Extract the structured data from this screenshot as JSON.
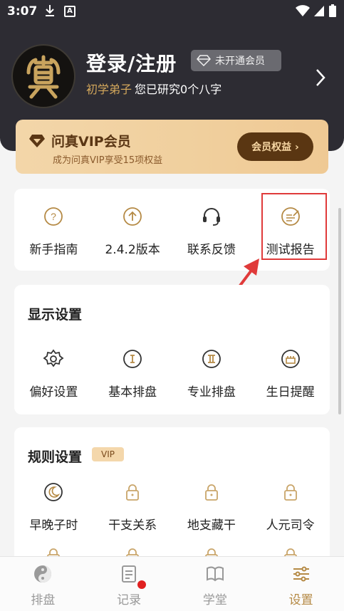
{
  "status_bar": {
    "time": "3:07"
  },
  "profile": {
    "login_title": "登录/注册",
    "vip_status": "未开通会员",
    "rank": "初学弟子",
    "study_text": "您已研究0个八字"
  },
  "vip_card": {
    "title": "问真VIP会员",
    "subtitle": "成为问真VIP享受15项权益",
    "button": "会员权益 ›"
  },
  "quick_items": [
    {
      "label": "新手指南",
      "icon": "question-icon"
    },
    {
      "label": "2.4.2版本",
      "icon": "upload-icon"
    },
    {
      "label": "联系反馈",
      "icon": "headset-icon"
    },
    {
      "label": "测试报告",
      "icon": "report-icon"
    }
  ],
  "display_settings": {
    "title": "显示设置",
    "items": [
      {
        "label": "偏好设置",
        "icon": "gear-icon"
      },
      {
        "label": "基本排盘",
        "icon": "one-icon"
      },
      {
        "label": "专业排盘",
        "icon": "two-icon"
      },
      {
        "label": "生日提醒",
        "icon": "cake-icon"
      }
    ]
  },
  "rule_settings": {
    "title": "规则设置",
    "tag": "VIP",
    "items": [
      {
        "label": "早晚子时",
        "icon": "moon-icon"
      },
      {
        "label": "干支关系",
        "icon": "lock-icon"
      },
      {
        "label": "地支藏干",
        "icon": "lock-icon"
      },
      {
        "label": "人元司令",
        "icon": "lock-icon"
      }
    ]
  },
  "bottom_nav": [
    {
      "label": "排盘",
      "icon": "yinyang-icon",
      "active": false
    },
    {
      "label": "记录",
      "icon": "notes-icon",
      "active": false
    },
    {
      "label": "学堂",
      "icon": "book-icon",
      "active": false
    },
    {
      "label": "设置",
      "icon": "settings-sliders-icon",
      "active": true
    }
  ],
  "colors": {
    "accent": "#b58a45",
    "header_bg": "#2d2c33",
    "highlight": "#e03a3a"
  }
}
